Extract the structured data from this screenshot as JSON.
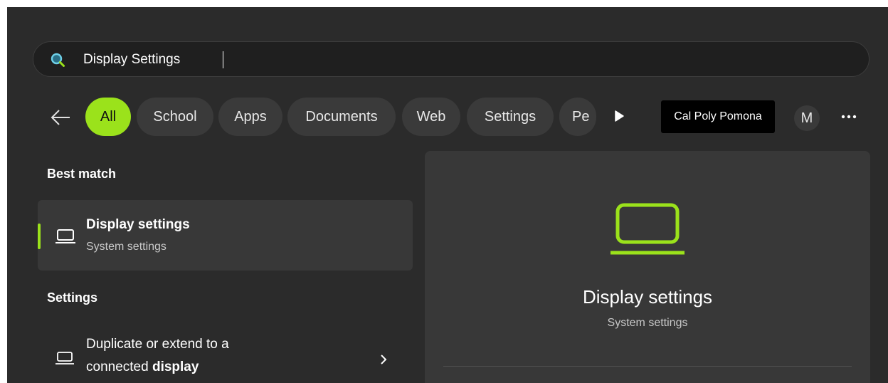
{
  "search": {
    "value": "Display Settings",
    "icon": "search-icon"
  },
  "filters": {
    "back_icon": "back-arrow-icon",
    "chips": [
      "All",
      "School",
      "Apps",
      "Documents",
      "Web",
      "Settings",
      "Pe"
    ],
    "active": "All",
    "next_icon": "play-icon",
    "org": "Cal Poly Pomona",
    "avatar_initial": "M",
    "more_icon": "more-icon"
  },
  "best_match": {
    "heading": "Best match",
    "title": "Display settings",
    "subtitle": "System settings",
    "icon": "laptop-icon"
  },
  "settings": {
    "heading": "Settings",
    "item_line1": "Duplicate or extend to a",
    "item_line2_prefix": "connected ",
    "item_line2_bold": "display",
    "icon": "laptop-icon",
    "chevron_icon": "chevron-right-icon"
  },
  "preview": {
    "title": "Display settings",
    "subtitle": "System settings",
    "icon": "laptop-icon"
  },
  "colors": {
    "accent": "#9be21b",
    "panel": "#2b2b2b",
    "card": "#383838",
    "search_bg": "#1f1f1f"
  }
}
